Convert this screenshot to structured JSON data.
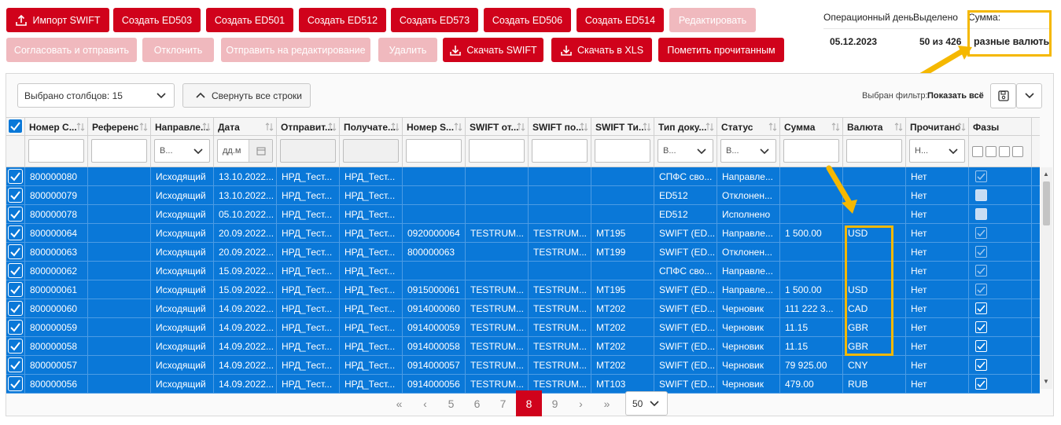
{
  "toolbar": {
    "row1": [
      "Импорт SWIFT",
      "Создать ED503",
      "Создать ED501",
      "Создать ED512",
      "Создать ED573",
      "Создать ED506",
      "Создать ED514",
      "Редактировать"
    ],
    "row2": [
      "Согласовать и отправить",
      "Отклонить",
      "Отправить на редактирование",
      "Удалить",
      "Скачать SWIFT",
      "Скачать в XLS",
      "Пометить прочитанным"
    ]
  },
  "info": {
    "op_day_label": "Операционный день",
    "op_day_value": "05.12.2023",
    "selected_label": "Выделено",
    "selected_value": "50 из 426",
    "sum_label": "Сумма:",
    "sum_value": "разные валюты"
  },
  "controls": {
    "columns_select": "Выбрано столбцов: 15",
    "collapse_rows": "Свернуть все строки",
    "filter_label": "Выбран фильтр:",
    "filter_value": "Показать всё"
  },
  "columns": [
    "Номер С...",
    "Референс",
    "Направле...",
    "Дата",
    "Отправит...",
    "Получате...",
    "Номер S...",
    "SWIFT от...",
    "SWIFT по...",
    "SWIFT Ти...",
    "Тип доку...",
    "Статус",
    "Сумма",
    "Валюта",
    "Прочитано",
    "Фазы"
  ],
  "filters": {
    "direction": "В...",
    "date": "дд.м",
    "doc_type": "В...",
    "status": "В...",
    "read": "Н..."
  },
  "rows": [
    [
      "800000080",
      "",
      "Исходящий",
      "13.10.2022...",
      "НРД_Тест...",
      "НРД_Тест...",
      "",
      "",
      "",
      "",
      "СПФС сво...",
      "Направле...",
      "",
      "",
      "Нет",
      "check"
    ],
    [
      "800000079",
      "",
      "Исходящий",
      "13.10.2022...",
      "НРД_Тест...",
      "НРД_Тест...",
      "",
      "",
      "",
      "",
      "ED512",
      "Отклонен...",
      "",
      "",
      "Нет",
      "box"
    ],
    [
      "800000078",
      "",
      "Исходящий",
      "05.10.2022...",
      "НРД_Тест...",
      "НРД_Тест...",
      "",
      "",
      "",
      "",
      "ED512",
      "Исполнено",
      "",
      "",
      "Нет",
      "box"
    ],
    [
      "800000064",
      "",
      "Исходящий",
      "20.09.2022...",
      "НРД_Тест...",
      "НРД_Тест...",
      "0920000064",
      "TESTRUM...",
      "TESTRUM...",
      "MT195",
      "SWIFT (ED...",
      "Направле...",
      "1 500.00",
      "USD",
      "Нет",
      "check"
    ],
    [
      "800000063",
      "",
      "Исходящий",
      "20.09.2022...",
      "НРД_Тест...",
      "НРД_Тест...",
      "800000063",
      "",
      "TESTRUM...",
      "MT199",
      "SWIFT (ED...",
      "Отклонен...",
      "",
      "",
      "Нет",
      "check"
    ],
    [
      "800000062",
      "",
      "Исходящий",
      "15.09.2022...",
      "НРД_Тест...",
      "НРД_Тест...",
      "",
      "",
      "",
      "",
      "СПФС сво...",
      "Направле...",
      "",
      "",
      "Нет",
      "check"
    ],
    [
      "800000061",
      "",
      "Исходящий",
      "15.09.2022...",
      "НРД_Тест...",
      "НРД_Тест...",
      "0915000061",
      "TESTRUM...",
      "TESTRUM...",
      "MT195",
      "SWIFT (ED...",
      "Направле...",
      "1 500.00",
      "USD",
      "Нет",
      "check"
    ],
    [
      "800000060",
      "",
      "Исходящий",
      "14.09.2022...",
      "НРД_Тест...",
      "НРД_Тест...",
      "0914000060",
      "TESTRUM...",
      "TESTRUM...",
      "MT202",
      "SWIFT (ED...",
      "Черновик",
      "111 222 3...",
      "CAD",
      "Нет",
      "checkw"
    ],
    [
      "800000059",
      "",
      "Исходящий",
      "14.09.2022...",
      "НРД_Тест...",
      "НРД_Тест...",
      "0914000059",
      "TESTRUM...",
      "TESTRUM...",
      "MT202",
      "SWIFT (ED...",
      "Черновик",
      "11.15",
      "GBR",
      "Нет",
      "checkw"
    ],
    [
      "800000058",
      "",
      "Исходящий",
      "14.09.2022...",
      "НРД_Тест...",
      "НРД_Тест...",
      "0914000058",
      "TESTRUM...",
      "TESTRUM...",
      "MT202",
      "SWIFT (ED...",
      "Черновик",
      "11.15",
      "GBR",
      "Нет",
      "checkw"
    ],
    [
      "800000057",
      "",
      "Исходящий",
      "14.09.2022...",
      "НРД_Тест...",
      "НРД_Тест...",
      "0914000057",
      "TESTRUM...",
      "TESTRUM...",
      "MT202",
      "SWIFT (ED...",
      "Черновик",
      "79 925.00",
      "CNY",
      "Нет",
      "checkw"
    ],
    [
      "800000056",
      "",
      "Исходящий",
      "14.09.2022...",
      "НРД_Тест...",
      "НРД_Тест...",
      "0914000056",
      "TESTRUM...",
      "TESTRUM...",
      "MT103",
      "SWIFT (ED...",
      "Черновик",
      "479.00",
      "RUB",
      "Нет",
      "checkw"
    ]
  ],
  "pagination": {
    "first": "«",
    "prev": "‹",
    "pages": [
      "5",
      "6",
      "7",
      "8",
      "9"
    ],
    "active": "8",
    "next": "›",
    "last": "»",
    "page_size": "50"
  },
  "colors": {
    "brand": "#d0021b",
    "brand_disabled": "#f0b9be",
    "row_selected": "#0a78d8",
    "highlight": "#f5b800"
  }
}
